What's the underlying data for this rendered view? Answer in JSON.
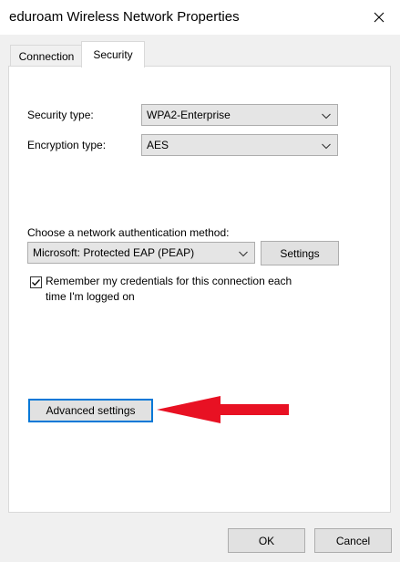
{
  "window": {
    "title": "eduroam Wireless Network Properties"
  },
  "tabs": [
    {
      "label": "Connection"
    },
    {
      "label": "Security"
    }
  ],
  "security": {
    "security_type_label": "Security type:",
    "security_type_value": "WPA2-Enterprise",
    "encryption_type_label": "Encryption type:",
    "encryption_type_value": "AES",
    "auth_method_label": "Choose a network authentication method:",
    "auth_method_value": "Microsoft: Protected EAP (PEAP)",
    "settings_button": "Settings",
    "remember_line1": "Remember my credentials for this connection each",
    "remember_line2": "time I'm logged on",
    "remember_checked": true,
    "advanced_button": "Advanced settings"
  },
  "footer": {
    "ok_button": "OK",
    "cancel_button": "Cancel"
  },
  "colors": {
    "accent": "#0078d7",
    "annotation_arrow": "#e81123"
  },
  "icons": {
    "close": "close-icon",
    "dropdown": "chevron-down-icon",
    "check": "checkmark-icon",
    "annotation": "red-arrow-icon"
  }
}
